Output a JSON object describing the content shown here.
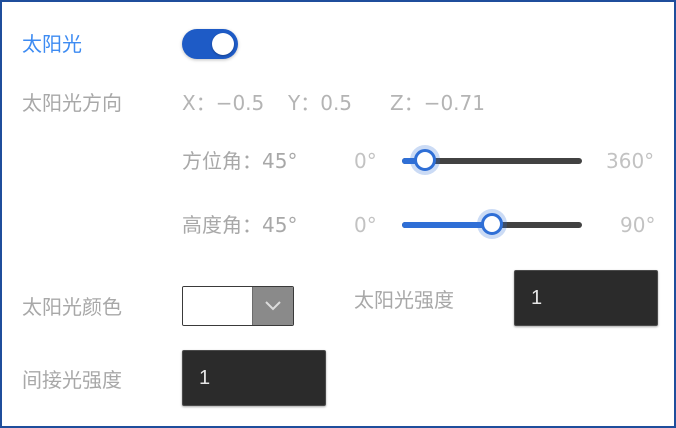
{
  "sunlight": {
    "label": "太阳光",
    "enabled": true
  },
  "direction": {
    "label": "太阳光方向",
    "x_text": "X：−0.5",
    "y_text": "Y：0.5",
    "z_text": "Z：−0.71"
  },
  "azimuth": {
    "label": "方位角：45°",
    "min_label": "0°",
    "max_label": "360°",
    "value": 45,
    "min": 0,
    "max": 360
  },
  "elevation": {
    "label": "高度角：45°",
    "min_label": "0°",
    "max_label": "90°",
    "value": 45,
    "min": 0,
    "max": 90
  },
  "sun_color": {
    "label": "太阳光颜色",
    "value": "#ffffff"
  },
  "sun_intensity": {
    "label": "太阳光强度",
    "value": "1"
  },
  "indirect_intensity": {
    "label": "间接光强度",
    "value": "1"
  },
  "colors": {
    "accent": "#2f6fd6",
    "toggle_on": "#1e5bc6",
    "active_label": "#3d8bf2",
    "input_bg": "#2b2b2b"
  },
  "icons": {
    "dropdown": "chevron-down-icon"
  }
}
